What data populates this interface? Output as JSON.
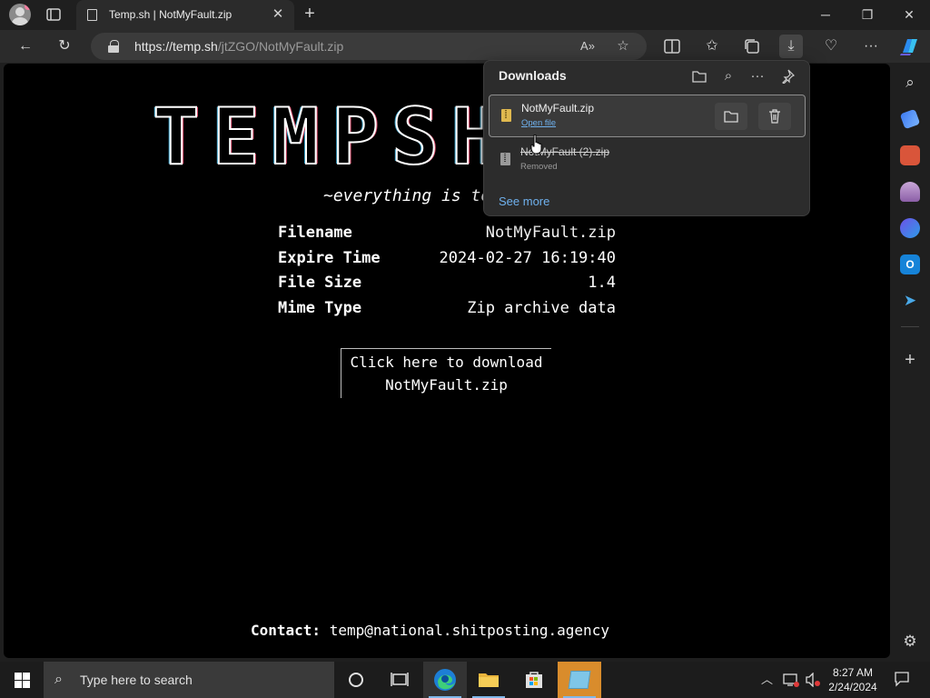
{
  "tab": {
    "title": "Temp.sh | NotMyFault.zip"
  },
  "address": {
    "url_host": "https://temp.sh",
    "url_path": "/jtZGO/NotMyFault.zip"
  },
  "page": {
    "logo": "TEMPSH",
    "tagline": "~everything is temporary",
    "info": [
      {
        "key": "Filename",
        "value": "NotMyFault.zip"
      },
      {
        "key": "Expire Time",
        "value": "2024-02-27 16:19:40"
      },
      {
        "key": "File Size",
        "value": "1.4"
      },
      {
        "key": "Mime Type",
        "value": "Zip archive data"
      }
    ],
    "download_line1": "Click here to download",
    "download_line2": "NotMyFault.zip",
    "contact_label": "Contact:",
    "contact_email": "temp@national.shitposting.agency"
  },
  "downloads": {
    "title": "Downloads",
    "items": [
      {
        "name": "NotMyFault.zip",
        "status": "Open file"
      },
      {
        "name": "NotMyFault (2).zip",
        "status": "Removed"
      }
    ],
    "see_more": "See more"
  },
  "taskbar": {
    "search_placeholder": "Type here to search",
    "time": "8:27 AM",
    "date": "2/24/2024"
  },
  "colors": {
    "accent_link": "#6fb1ee",
    "page_bg": "#000000",
    "chrome_bg": "#2b2b2b",
    "zip_icon": "#e0b94f"
  }
}
